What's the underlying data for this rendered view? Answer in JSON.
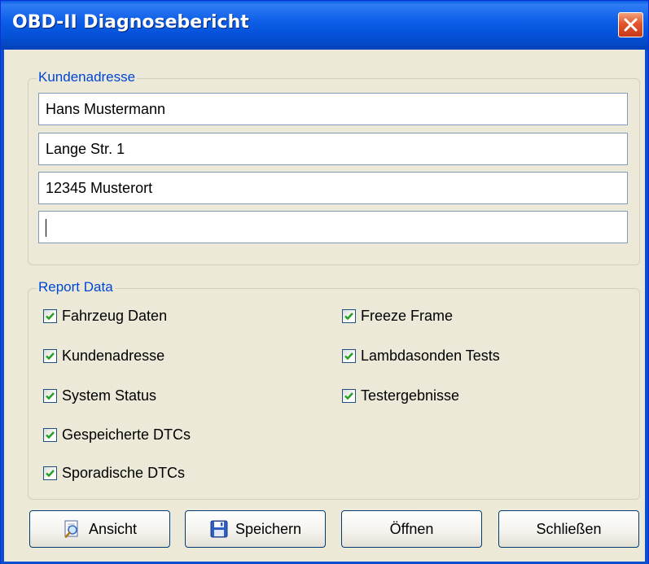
{
  "window": {
    "title": "OBD-II Diagnosebericht"
  },
  "address": {
    "legend": "Kundenadresse",
    "fields": [
      "Hans Mustermann",
      "Lange Str. 1",
      "12345 Musterort",
      ""
    ]
  },
  "report": {
    "legend": "Report Data",
    "left": [
      {
        "label": "Fahrzeug Daten",
        "checked": true
      },
      {
        "label": "Kundenadresse",
        "checked": true
      },
      {
        "label": "System Status",
        "checked": true
      },
      {
        "label": "Gespeicherte DTCs",
        "checked": true
      },
      {
        "label": "Sporadische DTCs",
        "checked": true
      }
    ],
    "right": [
      {
        "label": "Freeze Frame",
        "checked": true
      },
      {
        "label": "Lambdasonden Tests",
        "checked": true
      },
      {
        "label": "Testergebnisse",
        "checked": true
      }
    ]
  },
  "buttons": {
    "view": "Ansicht",
    "save": "Speichern",
    "open": "Öffnen",
    "close": "Schließen"
  },
  "icons": {
    "view": "preview-icon",
    "save": "floppy-disk-icon",
    "close": "close-icon",
    "check": "checkmark-icon"
  },
  "colors": {
    "title_bar": "#0552d8",
    "close_button": "#e3562b",
    "legend_text": "#0046d5",
    "checkmark": "#21a121"
  }
}
